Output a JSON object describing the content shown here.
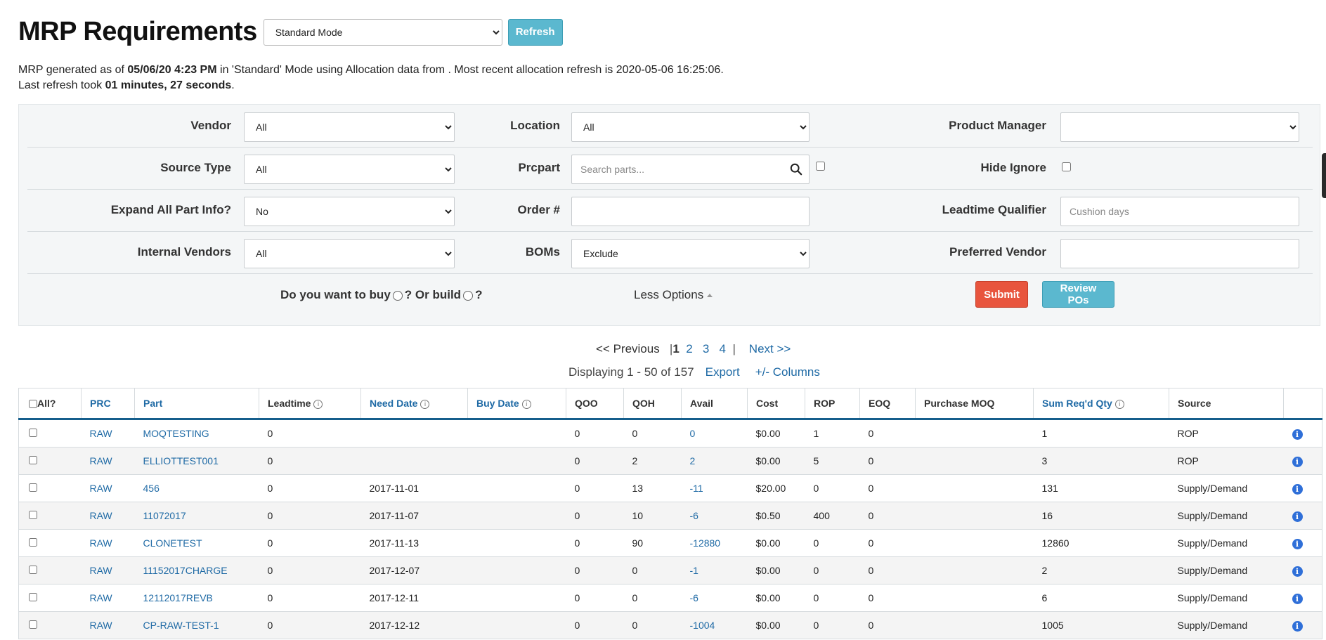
{
  "header": {
    "title": "MRP Requirements",
    "mode": "Standard Mode",
    "refresh_label": "Refresh"
  },
  "info": {
    "prefix": "MRP generated as of ",
    "generated_at": "05/06/20 4:23 PM",
    "middle": " in 'Standard' Mode using Allocation data from . Most recent allocation refresh is 2020-05-06 16:25:06.",
    "last_refresh_prefix": "Last refresh took ",
    "last_refresh_duration": "01 minutes, 27 seconds",
    "last_refresh_suffix": "."
  },
  "filters": {
    "vendor_label": "Vendor",
    "vendor_value": "All",
    "location_label": "Location",
    "location_value": "All",
    "product_manager_label": "Product Manager",
    "product_manager_value": "",
    "source_type_label": "Source Type",
    "source_type_value": "All",
    "prcpart_label": "Prcpart",
    "prcpart_placeholder": "Search parts...",
    "hide_ignore_label": "Hide Ignore",
    "expand_label": "Expand All Part Info?",
    "expand_value": "No",
    "order_label": "Order #",
    "order_value": "",
    "leadtime_label": "Leadtime Qualifier",
    "leadtime_placeholder": "Cushion days",
    "internal_vendors_label": "Internal Vendors",
    "internal_vendors_value": "All",
    "boms_label": "BOMs",
    "boms_value": "Exclude",
    "preferred_vendor_label": "Preferred Vendor",
    "preferred_vendor_value": "",
    "buy_question_prefix": "Do you want to ",
    "buy_word": "buy",
    "buy_q_suffix": "?",
    "or_text": " Or ",
    "build_word": "build",
    "build_q_suffix": "?",
    "less_options_label": "Less Options",
    "submit_label": "Submit",
    "review_label": "Review POs"
  },
  "pager": {
    "previous": "<< Previous",
    "pages": [
      "1",
      "2",
      "3",
      "4"
    ],
    "current": "1",
    "next": "Next >>",
    "displaying": "Displaying 1 - 50 of 157",
    "export": "Export",
    "columns": "+/- Columns"
  },
  "table": {
    "all_label": "All?",
    "headers": {
      "prc": "PRC",
      "part": "Part",
      "leadtime": "Leadtime",
      "need_date": "Need Date",
      "buy_date": "Buy Date",
      "qoo": "QOO",
      "qoh": "QOH",
      "avail": "Avail",
      "cost": "Cost",
      "rop": "ROP",
      "eoq": "EOQ",
      "moq": "Purchase MOQ",
      "sum": "Sum Req'd Qty",
      "source": "Source"
    },
    "rows": [
      {
        "prc": "RAW",
        "part": "MOQTESTING",
        "leadtime": "0",
        "need": "",
        "buy": "",
        "qoo": "0",
        "qoh": "0",
        "avail": "0",
        "cost": "$0.00",
        "rop": "1",
        "eoq": "0",
        "moq": "",
        "sum": "1",
        "source": "ROP"
      },
      {
        "prc": "RAW",
        "part": "ELLIOTTEST001",
        "leadtime": "0",
        "need": "",
        "buy": "",
        "qoo": "0",
        "qoh": "2",
        "avail": "2",
        "cost": "$0.00",
        "rop": "5",
        "eoq": "0",
        "moq": "",
        "sum": "3",
        "source": "ROP"
      },
      {
        "prc": "RAW",
        "part": "456",
        "leadtime": "0",
        "need": "2017-11-01",
        "buy": "",
        "qoo": "0",
        "qoh": "13",
        "avail": "-11",
        "cost": "$20.00",
        "rop": "0",
        "eoq": "0",
        "moq": "",
        "sum": "131",
        "source": "Supply/Demand"
      },
      {
        "prc": "RAW",
        "part": "11072017",
        "leadtime": "0",
        "need": "2017-11-07",
        "buy": "",
        "qoo": "0",
        "qoh": "10",
        "avail": "-6",
        "cost": "$0.50",
        "rop": "400",
        "eoq": "0",
        "moq": "",
        "sum": "16",
        "source": "Supply/Demand"
      },
      {
        "prc": "RAW",
        "part": "CLONETEST",
        "leadtime": "0",
        "need": "2017-11-13",
        "buy": "",
        "qoo": "0",
        "qoh": "90",
        "avail": "-12880",
        "cost": "$0.00",
        "rop": "0",
        "eoq": "0",
        "moq": "",
        "sum": "12860",
        "source": "Supply/Demand"
      },
      {
        "prc": "RAW",
        "part": "11152017CHARGE",
        "leadtime": "0",
        "need": "2017-12-07",
        "buy": "",
        "qoo": "0",
        "qoh": "0",
        "avail": "-1",
        "cost": "$0.00",
        "rop": "0",
        "eoq": "0",
        "moq": "",
        "sum": "2",
        "source": "Supply/Demand"
      },
      {
        "prc": "RAW",
        "part": "12112017REVB",
        "leadtime": "0",
        "need": "2017-12-11",
        "buy": "",
        "qoo": "0",
        "qoh": "0",
        "avail": "-6",
        "cost": "$0.00",
        "rop": "0",
        "eoq": "0",
        "moq": "",
        "sum": "6",
        "source": "Supply/Demand"
      },
      {
        "prc": "RAW",
        "part": "CP-RAW-TEST-1",
        "leadtime": "0",
        "need": "2017-12-12",
        "buy": "",
        "qoo": "0",
        "qoh": "0",
        "avail": "-1004",
        "cost": "$0.00",
        "rop": "0",
        "eoq": "0",
        "moq": "",
        "sum": "1005",
        "source": "Supply/Demand"
      }
    ]
  },
  "colors": {
    "link": "#1f6aa5",
    "info_button": "#5bb8cf",
    "submit_button": "#e8553e",
    "header_rule": "#155e8c",
    "panel_bg": "#f4f6f7"
  }
}
